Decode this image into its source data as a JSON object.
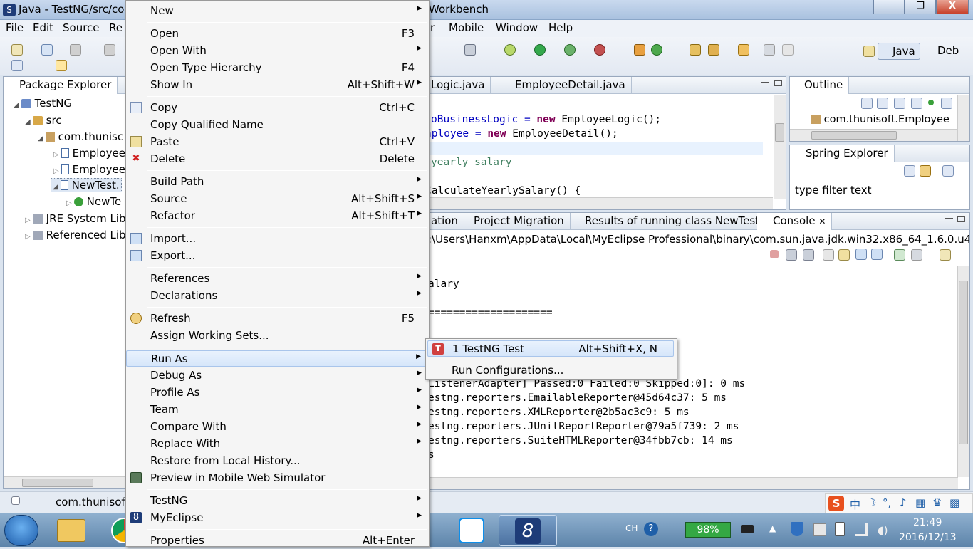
{
  "window": {
    "title_left": "Java - TestNG/src/co",
    "title_right": "Workbench",
    "min_label": "—",
    "max_label": "❐",
    "close_label": "X"
  },
  "menubar": [
    "File",
    "Edit",
    "Source",
    "Re",
    "r",
    "Mobile",
    "Window",
    "Help"
  ],
  "perspectives": {
    "java": "Java",
    "debug": "Deb"
  },
  "package_explorer": {
    "tab": "Package Explorer",
    "items": [
      "TestNG",
      "src",
      "com.thunisc",
      "Employee",
      "Employee",
      "NewTest.",
      "NewTe",
      "JRE System Lib",
      "Referenced Lib"
    ]
  },
  "editor": {
    "tabs": [
      "Logic.java",
      "EmployeeDetail.java"
    ],
    "lines": [
      {
        "a": "oBusinessLogic = ",
        "kw": "new",
        "b": " EmployeeLogic();"
      },
      {
        "a": "nployee = ",
        "kw": "new",
        "b": " EmployeeDetail();"
      },
      {
        "a": "yearly salary",
        "kw": "",
        "b": ""
      },
      {
        "a": "CalculateYearlySalary() {",
        "kw": "",
        "b": ""
      }
    ]
  },
  "outline": {
    "tab": "Outline",
    "item": "com.thunisoft.Employee"
  },
  "spring_explorer": {
    "tab": "Spring Explorer",
    "filter_placeholder": "type filter text"
  },
  "bottom": {
    "tabs": [
      "ation",
      "Project Migration",
      "Results of running class NewTest",
      "Console"
    ],
    "path": ":\\Users\\Hanxm\\AppData\\Local\\MyEclipse Professional\\binary\\com.sun.java.jdk.win32.x86_64_1.6.0.u43\\b",
    "lines": [
      "alary",
      "====================",
      "",
      "",
      "",
      "ListenerAdapter] Passed:0 Failed:0 Skipped:0]: 0 ms",
      "estng.reporters.EmailableReporter@45d64c37: 5 ms",
      "estng.reporters.XMLReporter@2b5ac3c9: 5 ms",
      "estng.reporters.JUnitReportReporter@79a5f739: 2 ms",
      "estng.reporters.SuiteHTMLReporter@34fbb7cb: 14 ms",
      "s"
    ]
  },
  "status": {
    "text": "com.thunisof"
  },
  "context_menu": [
    {
      "label": "New",
      "shortcut": "",
      "submenu": true,
      "icon": ""
    },
    {
      "sep": true
    },
    {
      "label": "Open",
      "shortcut": "F3",
      "submenu": false,
      "icon": ""
    },
    {
      "label": "Open With",
      "shortcut": "",
      "submenu": true,
      "icon": ""
    },
    {
      "label": "Open Type Hierarchy",
      "shortcut": "F4",
      "submenu": false,
      "icon": ""
    },
    {
      "label": "Show In",
      "shortcut": "Alt+Shift+W",
      "submenu": true,
      "icon": ""
    },
    {
      "sep": true
    },
    {
      "label": "Copy",
      "shortcut": "Ctrl+C",
      "submenu": false,
      "icon": "copy-icon"
    },
    {
      "label": "Copy Qualified Name",
      "shortcut": "",
      "submenu": false,
      "icon": ""
    },
    {
      "label": "Paste",
      "shortcut": "Ctrl+V",
      "submenu": false,
      "icon": "paste-icon"
    },
    {
      "label": "Delete",
      "shortcut": "Delete",
      "submenu": false,
      "icon": "delete-icon"
    },
    {
      "sep": true
    },
    {
      "label": "Build Path",
      "shortcut": "",
      "submenu": true,
      "icon": ""
    },
    {
      "label": "Source",
      "shortcut": "Alt+Shift+S",
      "submenu": true,
      "icon": ""
    },
    {
      "label": "Refactor",
      "shortcut": "Alt+Shift+T",
      "submenu": true,
      "icon": ""
    },
    {
      "sep": true
    },
    {
      "label": "Import...",
      "shortcut": "",
      "submenu": false,
      "icon": "import-icon"
    },
    {
      "label": "Export...",
      "shortcut": "",
      "submenu": false,
      "icon": "export-icon"
    },
    {
      "sep": true
    },
    {
      "label": "References",
      "shortcut": "",
      "submenu": true,
      "icon": ""
    },
    {
      "label": "Declarations",
      "shortcut": "",
      "submenu": true,
      "icon": ""
    },
    {
      "sep": true
    },
    {
      "label": "Refresh",
      "shortcut": "F5",
      "submenu": false,
      "icon": "refresh-icon"
    },
    {
      "label": "Assign Working Sets...",
      "shortcut": "",
      "submenu": false,
      "icon": ""
    },
    {
      "sep": true
    },
    {
      "label": "Run As",
      "shortcut": "",
      "submenu": true,
      "icon": "",
      "highlight": true
    },
    {
      "label": "Debug As",
      "shortcut": "",
      "submenu": true,
      "icon": ""
    },
    {
      "label": "Profile As",
      "shortcut": "",
      "submenu": true,
      "icon": ""
    },
    {
      "label": "Team",
      "shortcut": "",
      "submenu": true,
      "icon": ""
    },
    {
      "label": "Compare With",
      "shortcut": "",
      "submenu": true,
      "icon": ""
    },
    {
      "label": "Replace With",
      "shortcut": "",
      "submenu": true,
      "icon": ""
    },
    {
      "label": "Restore from Local History...",
      "shortcut": "",
      "submenu": false,
      "icon": ""
    },
    {
      "label": "Preview in Mobile Web Simulator",
      "shortcut": "",
      "submenu": false,
      "icon": "mobile-icon"
    },
    {
      "sep": true
    },
    {
      "label": "TestNG",
      "shortcut": "",
      "submenu": true,
      "icon": ""
    },
    {
      "label": "MyEclipse",
      "shortcut": "",
      "submenu": true,
      "icon": "myeclipse-icon"
    },
    {
      "sep": true
    },
    {
      "label": "Properties",
      "shortcut": "Alt+Enter",
      "submenu": false,
      "icon": ""
    }
  ],
  "run_as_submenu": [
    {
      "label": "1 TestNG Test",
      "shortcut": "Alt+Shift+X, N"
    },
    {
      "label": "Run Configurations...",
      "shortcut": ""
    }
  ],
  "taskbar": {
    "lang": "CH",
    "battery": "98%",
    "time": "21:49",
    "date": "2016/12/13",
    "ime": "中"
  }
}
